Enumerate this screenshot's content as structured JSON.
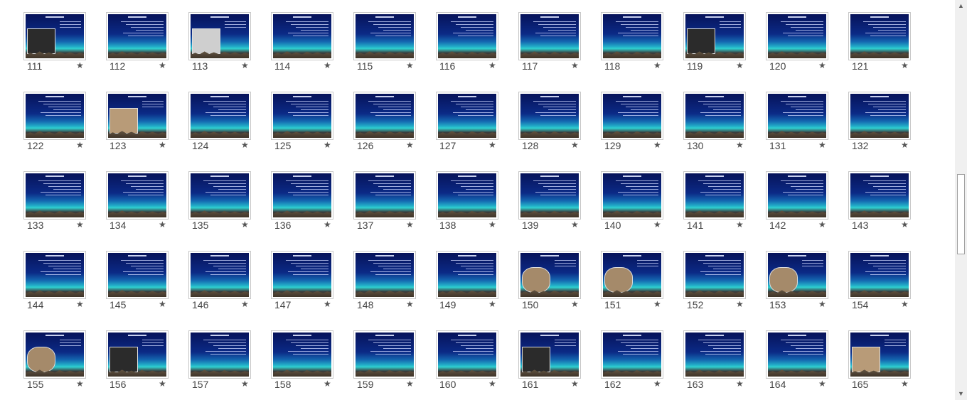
{
  "slides": [
    [
      "111",
      "★"
    ],
    [
      "112",
      "★"
    ],
    [
      "113",
      "★"
    ],
    [
      "114",
      "★"
    ],
    [
      "115",
      "★"
    ],
    [
      "116",
      "★"
    ],
    [
      "117",
      "★"
    ],
    [
      "118",
      "★"
    ],
    [
      "119",
      "★"
    ],
    [
      "120",
      "★"
    ],
    [
      "121",
      "★"
    ],
    [
      "122",
      "★"
    ],
    [
      "123",
      "★"
    ],
    [
      "124",
      "★"
    ],
    [
      "125",
      "★"
    ],
    [
      "126",
      "★"
    ],
    [
      "127",
      "★"
    ],
    [
      "128",
      "★"
    ],
    [
      "129",
      "★"
    ],
    [
      "130",
      "★"
    ],
    [
      "131",
      "★"
    ],
    [
      "132",
      "★"
    ],
    [
      "133",
      "★"
    ],
    [
      "134",
      "★"
    ],
    [
      "135",
      "★"
    ],
    [
      "136",
      "★"
    ],
    [
      "137",
      "★"
    ],
    [
      "138",
      "★"
    ],
    [
      "139",
      "★"
    ],
    [
      "140",
      "★"
    ],
    [
      "141",
      "★"
    ],
    [
      "142",
      "★"
    ],
    [
      "143",
      "★"
    ],
    [
      "144",
      "★"
    ],
    [
      "145",
      "★"
    ],
    [
      "146",
      "★"
    ],
    [
      "147",
      "★"
    ],
    [
      "148",
      "★"
    ],
    [
      "149",
      "★"
    ],
    [
      "150",
      "★"
    ],
    [
      "151",
      "★"
    ],
    [
      "152",
      "★"
    ],
    [
      "153",
      "★"
    ],
    [
      "154",
      "★"
    ],
    [
      "155",
      "★"
    ],
    [
      "156",
      "★"
    ],
    [
      "157",
      "★"
    ],
    [
      "158",
      "★"
    ],
    [
      "159",
      "★"
    ],
    [
      "160",
      "★"
    ],
    [
      "161",
      "★"
    ],
    [
      "162",
      "★"
    ],
    [
      "163",
      "★"
    ],
    [
      "164",
      "★"
    ],
    [
      "165",
      "★"
    ]
  ],
  "slides_with_pictures": {
    "111": "dark-fossil",
    "113": "grey-fossil",
    "119": "dark-fossil",
    "123": "beige-grid",
    "150": "round-fossil",
    "151": "round-fossil",
    "153": "round-fossil",
    "155": "round-fossil",
    "156": "dark-fossil",
    "161": "dark-fossil",
    "165": "beige-grid"
  },
  "scrollbar": {
    "up_icon": "▲",
    "down_icon": "▼",
    "position_fraction": 0.44
  },
  "colors": {
    "slide_top": "#07135a",
    "slide_horizon": "#2fd0d0",
    "background": "#ffffff"
  }
}
